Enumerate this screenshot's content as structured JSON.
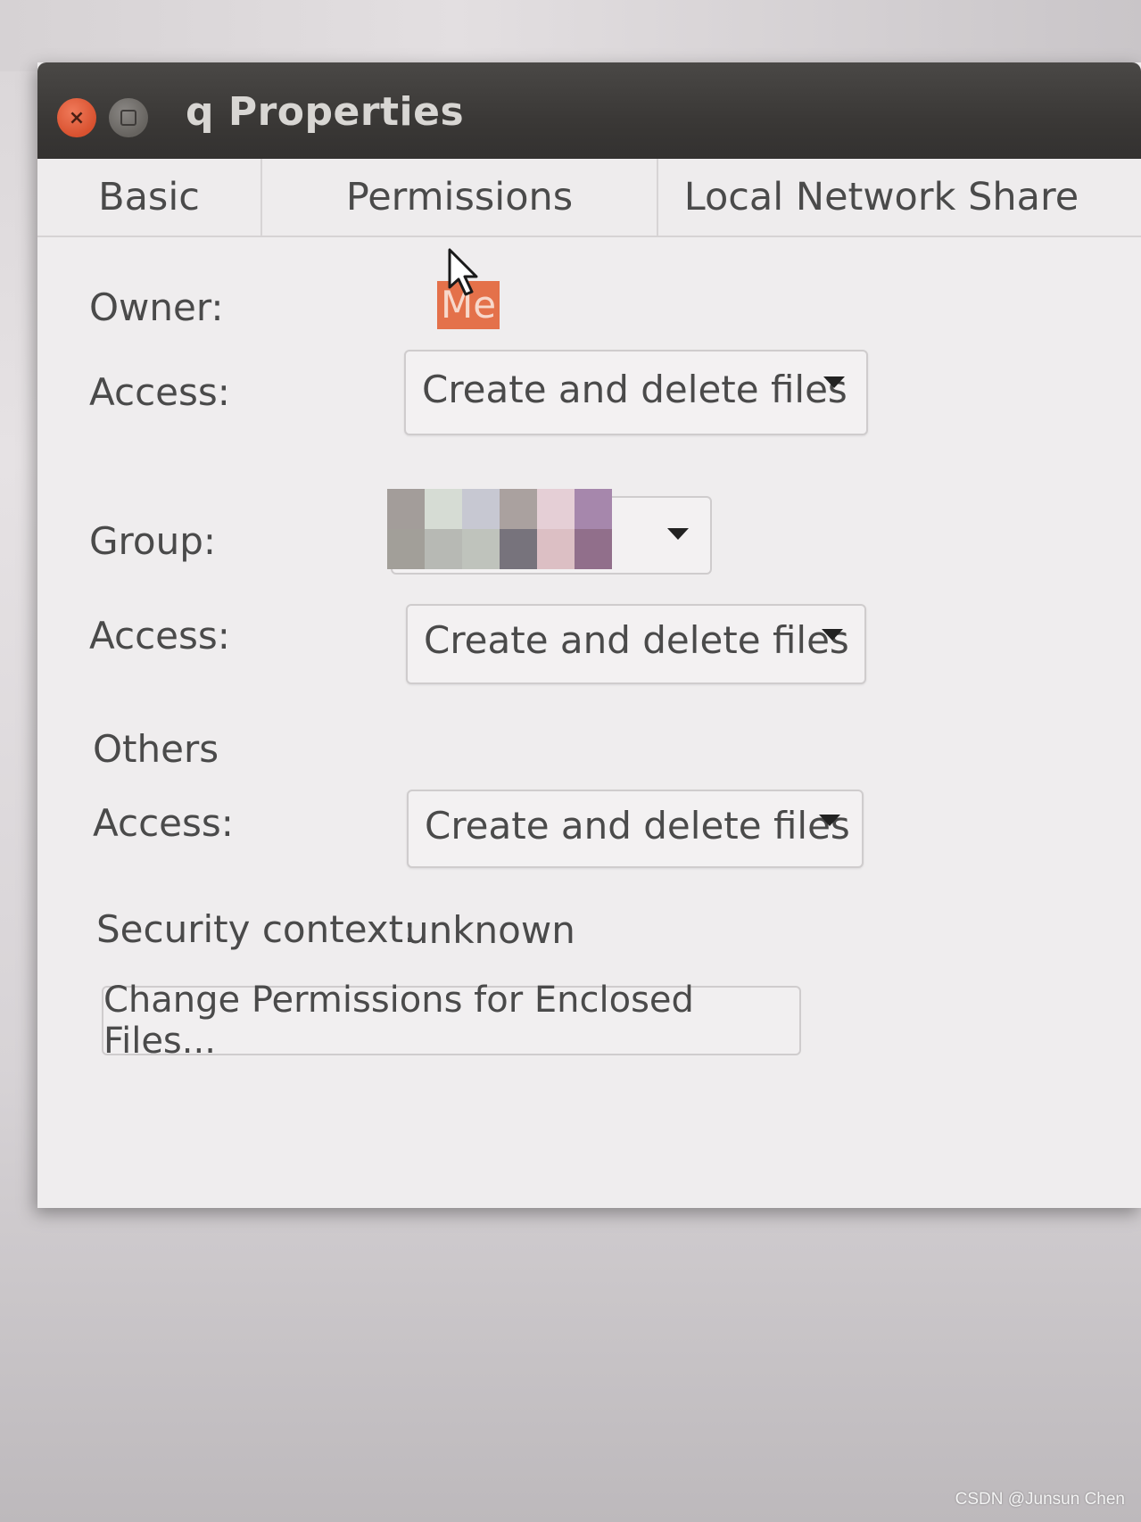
{
  "window": {
    "title": "q Properties"
  },
  "tabs": [
    {
      "label": "Basic"
    },
    {
      "label": "Permissions"
    },
    {
      "label": "Local Network Share"
    }
  ],
  "permissions": {
    "owner_label": "Owner:",
    "owner_value": "Me",
    "owner_access_label": "Access:",
    "owner_access_value": "Create and delete files",
    "group_label": "Group:",
    "group_value": "",
    "group_access_label": "Access:",
    "group_access_value": "Create and delete files",
    "others_heading": "Others",
    "others_access_label": "Access:",
    "others_access_value": "Create and delete files",
    "security_label": "Security context:",
    "security_value": "unknown",
    "enclosed_button_label": "Change Permissions for Enclosed Files..."
  },
  "watermark": "CSDN @Junsun Chen",
  "colors": {
    "titlebar": "#3a3836",
    "close_button": "#e0603d",
    "owner_highlight": "#e4714a",
    "window_bg": "#efedee"
  },
  "icons": {
    "close": "close-icon",
    "minimize": "minimize-icon",
    "dropdown": "chevron-down-icon",
    "cursor": "mouse-pointer-icon"
  }
}
